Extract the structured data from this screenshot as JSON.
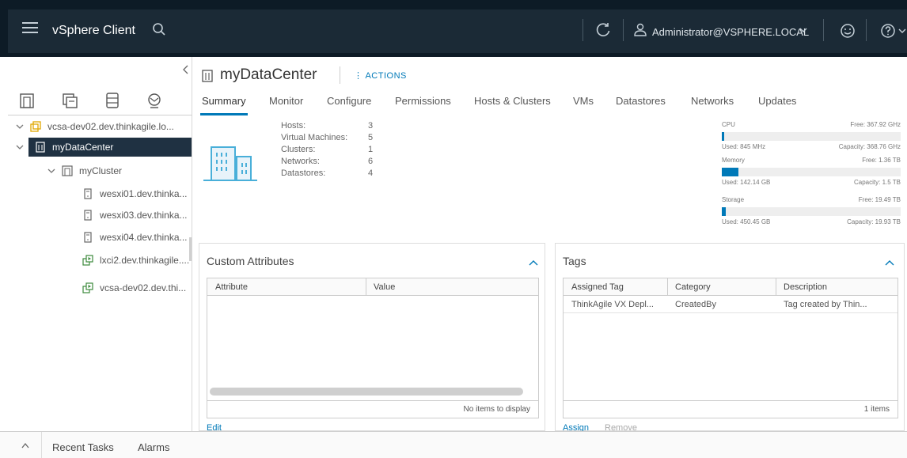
{
  "header": {
    "app_title": "vSphere Client",
    "user": "Administrator@VSPHERE.LOCAL"
  },
  "icons": {
    "menu": "hamburger-icon",
    "search": "search-icon",
    "refresh": "refresh-icon",
    "user": "user-icon",
    "feedback": "smiley-icon",
    "help": "help-icon"
  },
  "colors": {
    "header_bg": "#1b2a36",
    "accent": "#0079b8",
    "selected_bg": "#1f3142"
  },
  "tree": [
    {
      "label": "vcsa-dev02.dev.thinkagile.lo...",
      "level": 0,
      "expanded": true,
      "icon": "vcenter-icon"
    },
    {
      "label": "myDataCenter",
      "level": 1,
      "expanded": true,
      "icon": "datacenter-icon",
      "selected": true
    },
    {
      "label": "myCluster",
      "level": 2,
      "expanded": true,
      "icon": "cluster-icon"
    },
    {
      "label": "wesxi01.dev.thinka...",
      "level": 3,
      "icon": "host-icon"
    },
    {
      "label": "wesxi03.dev.thinka...",
      "level": 3,
      "icon": "host-icon"
    },
    {
      "label": "wesxi04.dev.thinka...",
      "level": 3,
      "icon": "host-icon"
    },
    {
      "label": "lxci2.dev.thinkagile....",
      "level": 3,
      "icon": "vm-icon"
    },
    {
      "label": "vcsa-dev02.dev.thi...",
      "level": 3,
      "icon": "vm-icon"
    }
  ],
  "main": {
    "title": "myDataCenter",
    "actions": "ACTIONS",
    "tabs": [
      "Summary",
      "Monitor",
      "Configure",
      "Permissions",
      "Hosts & Clusters",
      "VMs",
      "Datastores",
      "Networks",
      "Updates"
    ],
    "active_tab": "Summary",
    "stats": [
      {
        "label": "Hosts:",
        "value": "3"
      },
      {
        "label": "Virtual Machines:",
        "value": "5"
      },
      {
        "label": "Clusters:",
        "value": "1"
      },
      {
        "label": "Networks:",
        "value": "6"
      },
      {
        "label": "Datastores:",
        "value": "4"
      }
    ],
    "resources": [
      {
        "name": "CPU",
        "free": "Free: 367.92 GHz",
        "used": "Used: 845 MHz",
        "capacity": "Capacity: 368.76 GHz",
        "fraction": 0.002
      },
      {
        "name": "Memory",
        "free": "Free: 1.36 TB",
        "used": "Used: 142.14 GB",
        "capacity": "Capacity: 1.5 TB",
        "fraction": 0.093
      },
      {
        "name": "Storage",
        "free": "Free: 19.49 TB",
        "used": "Used: 450.45 GB",
        "capacity": "Capacity: 19.93 TB",
        "fraction": 0.022
      }
    ]
  },
  "custom_attributes": {
    "title": "Custom Attributes",
    "columns": [
      "Attribute",
      "Value"
    ],
    "footer": "No items to display",
    "edit_label": "Edit"
  },
  "tags": {
    "title": "Tags",
    "columns": [
      "Assigned Tag",
      "Category",
      "Description"
    ],
    "rows": [
      [
        "ThinkAgile VX Depl...",
        "CreatedBy",
        "Tag created by Thin..."
      ]
    ],
    "footer": "1 items",
    "assign_label": "Assign",
    "remove_label": "Remove"
  },
  "bottom": {
    "recent_tasks": "Recent Tasks",
    "alarms": "Alarms"
  }
}
